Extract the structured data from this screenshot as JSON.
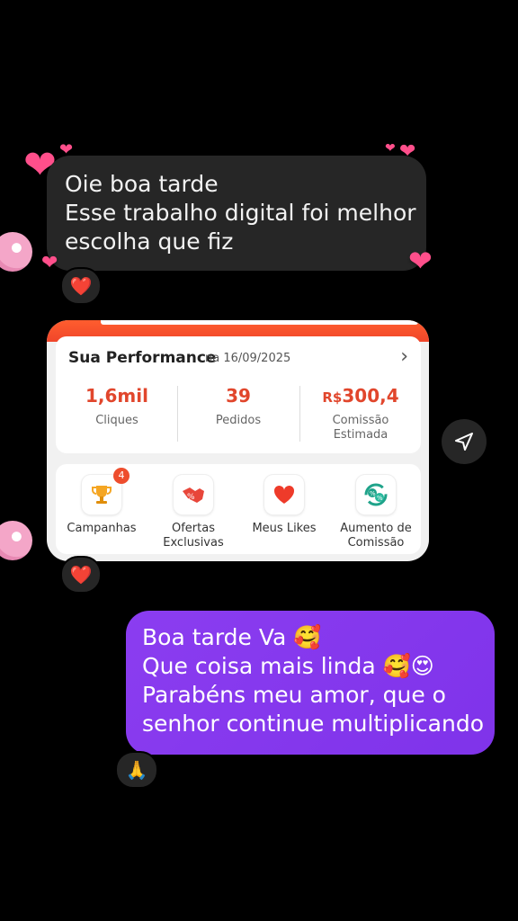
{
  "received_message": {
    "lines": [
      "Oie boa tarde",
      "Esse trabalho digital foi melhor",
      "escolha que fiz"
    ],
    "reaction": "❤️"
  },
  "shared_card": {
    "title": "Sua Performance",
    "date": "na 16/09/2025",
    "stats": [
      {
        "value": "1,6mil",
        "label": "Cliques"
      },
      {
        "value": "39",
        "label": "Pedidos"
      },
      {
        "value_prefix": "R$",
        "value": "300,4",
        "label_line1": "Comissão",
        "label_line2": "Estimada"
      }
    ],
    "shortcuts": [
      {
        "icon": "trophy-icon",
        "label": "Campanhas",
        "badge": "4"
      },
      {
        "icon": "handshake-icon",
        "label_line1": "Ofertas",
        "label_line2": "Exclusivas"
      },
      {
        "icon": "heart-icon",
        "label": "Meus Likes"
      },
      {
        "icon": "percent-cycle-icon",
        "label_line1": "Aumento de",
        "label_line2": "Comissão"
      }
    ],
    "reaction": "❤️"
  },
  "sent_message": {
    "lines": [
      "Boa tarde Va 🥰",
      "Que coisa mais linda 🥰😍",
      "Parabéns meu amor, que o",
      "senhor continue multiplicando"
    ],
    "reaction": "🙏"
  },
  "colors": {
    "sent_bubble": "#8b3df0",
    "received_bubble": "#262626",
    "brand_orange": "#ee4d2d"
  }
}
